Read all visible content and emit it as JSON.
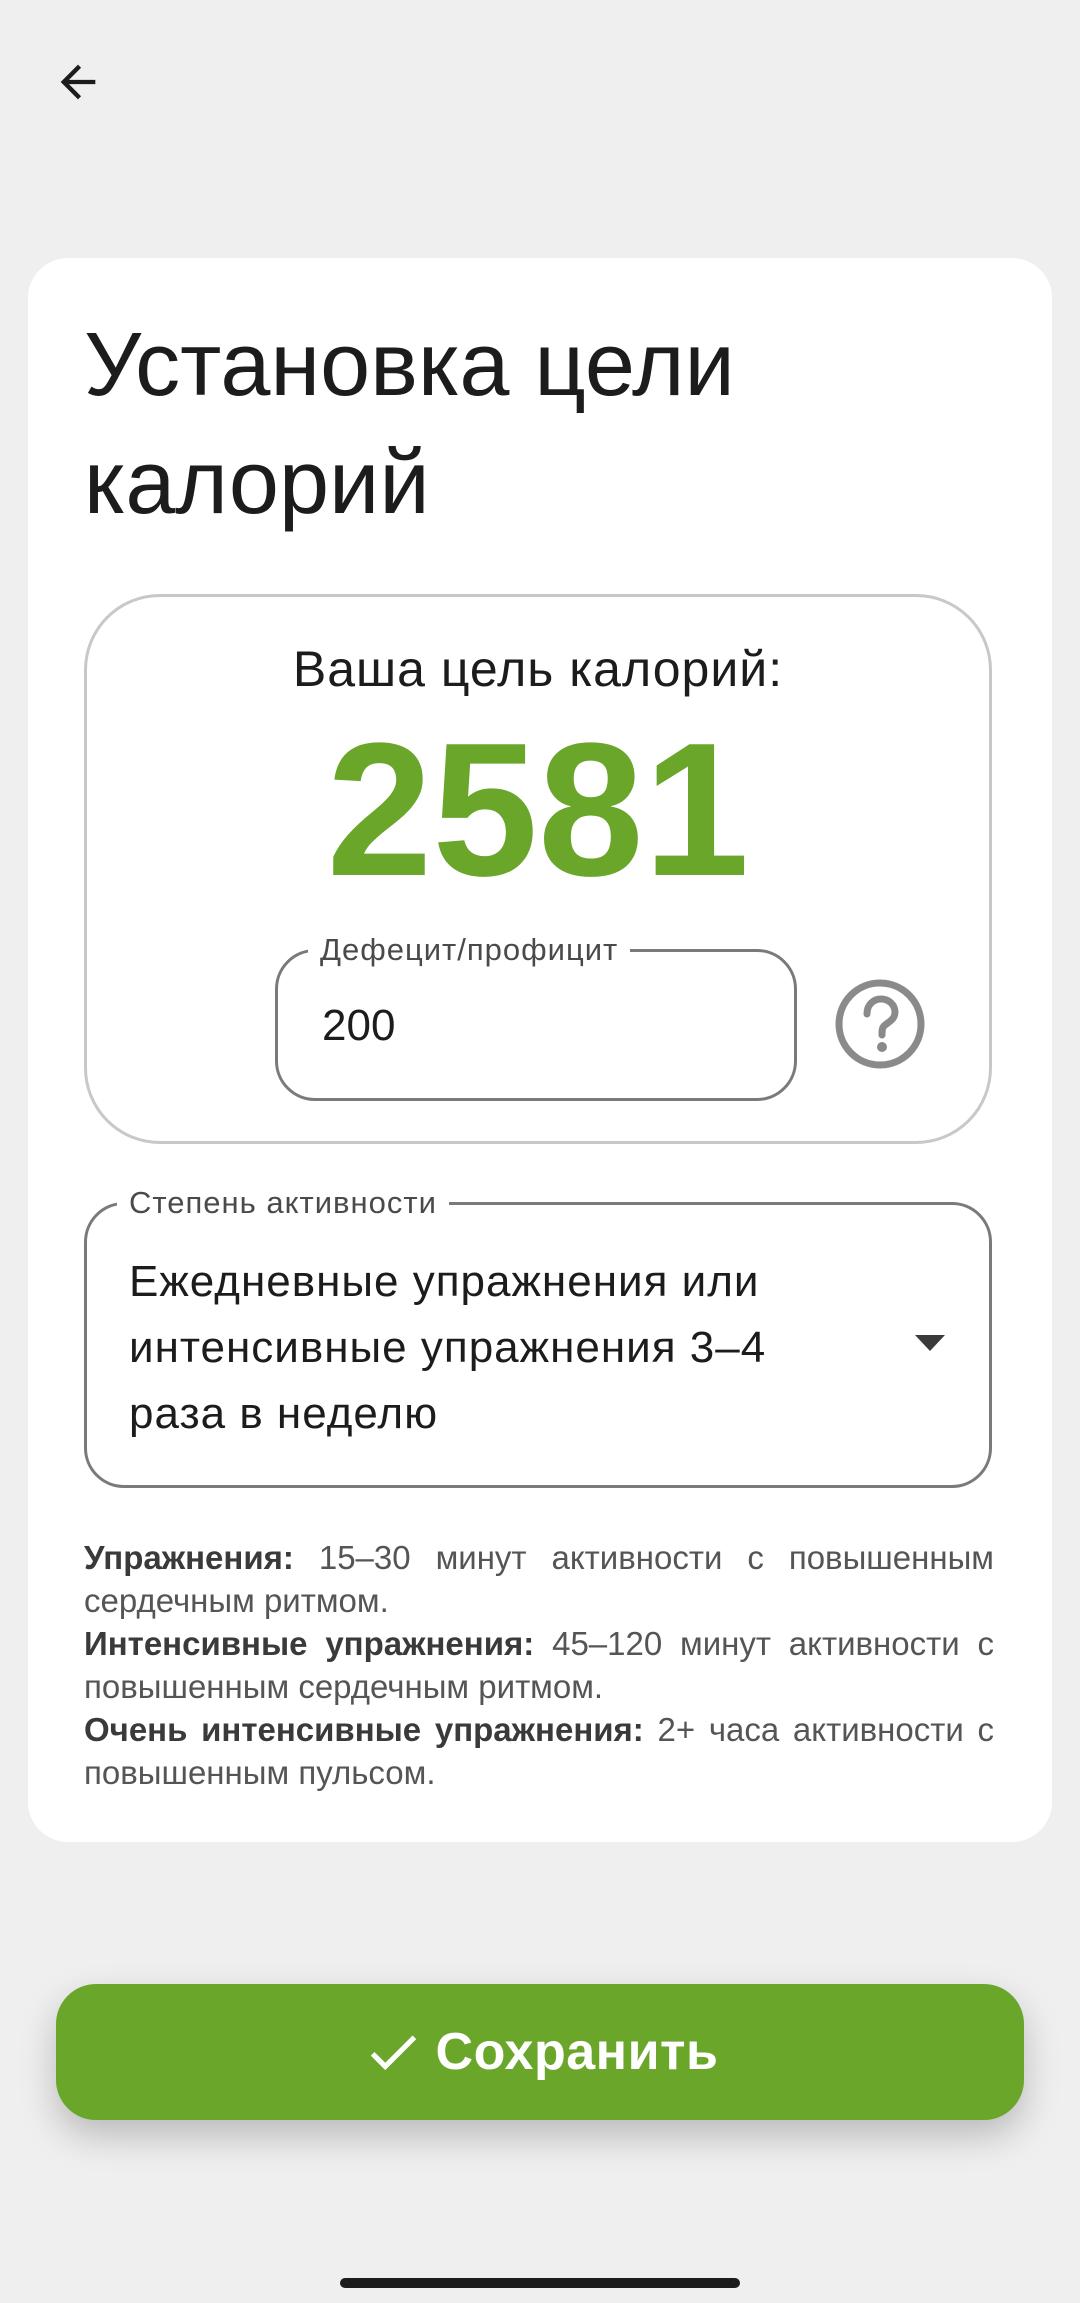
{
  "header": {
    "back_icon": "arrow-left-icon"
  },
  "card": {
    "title": "Установка цели калорий",
    "goal": {
      "label": "Ваша цель калорий:",
      "value": "2581",
      "value_color": "#6aa62a"
    },
    "deficit_field": {
      "label": "Дефецит/профицит",
      "value": "200"
    },
    "help_icon": "question-circle-icon",
    "activity_field": {
      "label": "Степень активности",
      "value": "Ежедневные упражнения или интенсивные упражнения 3–4 раза в неделю",
      "icon": "dropdown-arrow-icon"
    },
    "info": [
      {
        "term": "Упражнения:",
        "text": " 15–30 минут активности с повышенным сердечным ритмом."
      },
      {
        "term": "Интенсивные упражнения:",
        "text": " 45–120 минут активности с повышенным сердечным ритмом."
      },
      {
        "term": "Очень интенсивные упражнения:",
        "text": " 2+ часа активности с повышенным пульсом."
      }
    ]
  },
  "save_button": {
    "label": "Сохранить",
    "icon": "check-icon",
    "color": "#6aa62a"
  },
  "colors": {
    "background": "#efefef",
    "card": "#ffffff",
    "accent": "#6aa62a"
  }
}
